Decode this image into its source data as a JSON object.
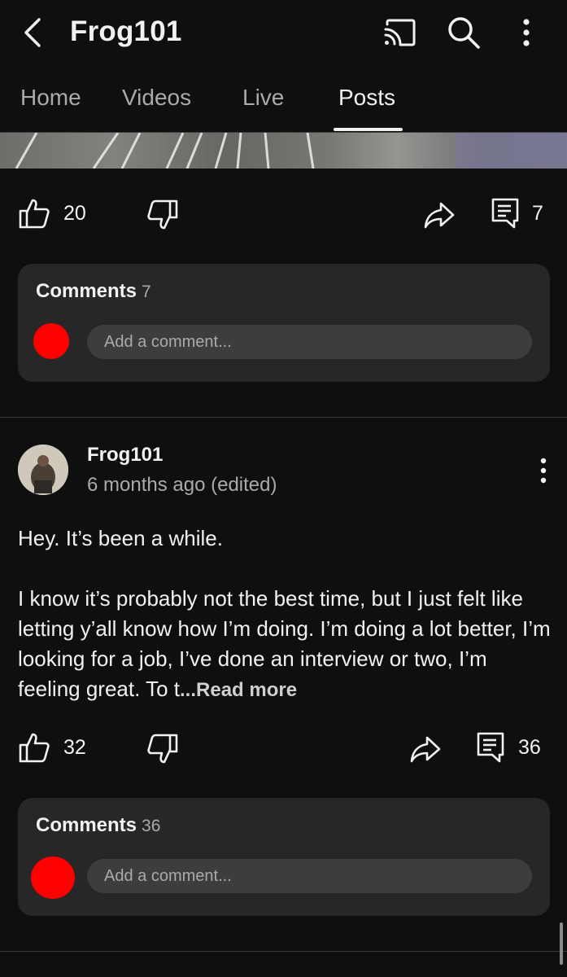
{
  "header": {
    "title": "Frog101"
  },
  "tabs": [
    {
      "label": "Home"
    },
    {
      "label": "Videos"
    },
    {
      "label": "Live"
    },
    {
      "label": "Posts",
      "active": true
    }
  ],
  "post1": {
    "likes": "20",
    "comment_count": "7",
    "comments_card": {
      "title": "Comments",
      "count": "7",
      "placeholder": "Add a comment..."
    }
  },
  "post2": {
    "author": "Frog101",
    "time": "6 months ago (edited)",
    "paragraph1": "Hey. It’s been a while.",
    "paragraph2": "I know it’s probably not the best time, but I just felt like letting y’all know how I’m doing. I’m doing a lot better, I’m looking for a job, I’ve done an interview or two, I’m feeling great. To t",
    "ellipsis": "...",
    "read_more": "Read more",
    "likes": "32",
    "comment_count": "36",
    "comments_card": {
      "title": "Comments",
      "count": "36",
      "placeholder": "Add a comment..."
    }
  },
  "icons": [
    "back-arrow-icon",
    "cast-icon",
    "search-icon",
    "more-vert-icon",
    "thumb-up-icon",
    "thumb-down-icon",
    "share-icon",
    "comment-icon"
  ],
  "colors": {
    "background": "#0f0f0f",
    "card": "#272727",
    "avatar_placeholder": "#ff0000",
    "muted_text": "#aaaaaa"
  }
}
